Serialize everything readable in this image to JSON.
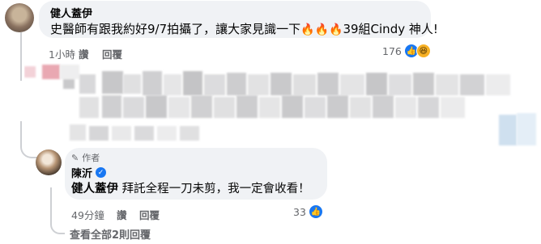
{
  "comment": {
    "author": "健人蓋伊",
    "text": "史醫師有跟我約好9/7拍攝了，讓大家見識一下",
    "emoji": "🔥🔥🔥",
    "text_suffix": "39組Cindy 神人!",
    "time": "1小時",
    "like_label": "讚",
    "reply_label": "回覆",
    "reaction_count": "176"
  },
  "reply": {
    "author_tag": "作者",
    "author": "陳沂",
    "mention": "健人蓋伊",
    "text": " 拜託全程一刀未剪，我一定會收看！",
    "time": "49分鐘",
    "like_label": "讚",
    "reply_label": "回覆",
    "reaction_count": "33"
  },
  "view_replies_label": "查看全部2則回覆",
  "colors": {
    "bubble": "#f0f2f5",
    "meta_text": "#65676b",
    "like_blue": "#1877f2",
    "haha_yellow": "#f7b125"
  }
}
